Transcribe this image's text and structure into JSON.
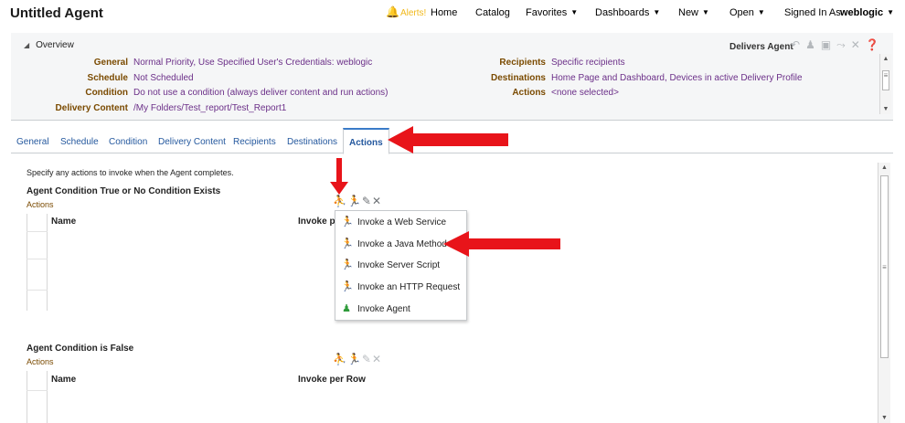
{
  "header": {
    "title": "Untitled Agent",
    "alerts_label": "Alerts!",
    "nav": [
      {
        "label": "Home"
      },
      {
        "label": "Catalog"
      },
      {
        "label": "Favorites",
        "caret": "▼"
      },
      {
        "label": "Dashboards",
        "caret": "▼"
      },
      {
        "label": "New",
        "caret": "▼"
      },
      {
        "label": "Open",
        "caret": "▼"
      }
    ],
    "signed_in_as": "Signed In As",
    "user": "weblogic",
    "user_caret": "▼"
  },
  "overview": {
    "heading": "Overview",
    "context": "Delivers Agent",
    "left_rows": [
      {
        "label": "General",
        "value": "Normal Priority, Use Specified User's Credentials: weblogic"
      },
      {
        "label": "Schedule",
        "value": "Not Scheduled"
      },
      {
        "label": "Condition",
        "value": "Do not use a condition (always deliver content and run actions)"
      },
      {
        "label": "Delivery Content",
        "value": "/My Folders/Test_report/Test_Report1"
      }
    ],
    "right_rows": [
      {
        "label": "Recipients",
        "value": "Specific recipients"
      },
      {
        "label": "Destinations",
        "value": "Home Page and Dashboard, Devices in active Delivery Profile"
      },
      {
        "label": "Actions",
        "value": "<none selected>"
      }
    ]
  },
  "tabs": [
    {
      "label": "General"
    },
    {
      "label": "Schedule"
    },
    {
      "label": "Condition"
    },
    {
      "label": "Delivery Content"
    },
    {
      "label": "Recipients"
    },
    {
      "label": "Destinations"
    },
    {
      "label": "Actions",
      "active": true
    }
  ],
  "actions_page": {
    "hint": "Specify any actions to invoke when the Agent completes.",
    "section_true": {
      "title": "Agent Condition True or No Condition Exists",
      "subtitle": "Actions",
      "columns": [
        "Name",
        "Invoke p"
      ]
    },
    "section_false": {
      "title": "Agent Condition is False",
      "subtitle": "Actions",
      "columns": [
        "Name",
        "Invoke per Row"
      ]
    },
    "menu": [
      {
        "label": "Invoke a Web Service",
        "icon": "runner-icon"
      },
      {
        "label": "Invoke a Java Method",
        "icon": "runner-icon"
      },
      {
        "label": "Invoke Server Script",
        "icon": "runner-icon"
      },
      {
        "label": "Invoke an HTTP Request",
        "icon": "runner-icon"
      },
      {
        "label": "Invoke Agent",
        "icon": "agent-icon"
      }
    ]
  },
  "colors": {
    "accent": "#3a7bc8",
    "tab_text": "#24589e",
    "overview_value": "#6b2f88",
    "overview_label": "#7a4a00",
    "annotation_arrow": "#e8141a",
    "alert": "#f1b81a"
  }
}
